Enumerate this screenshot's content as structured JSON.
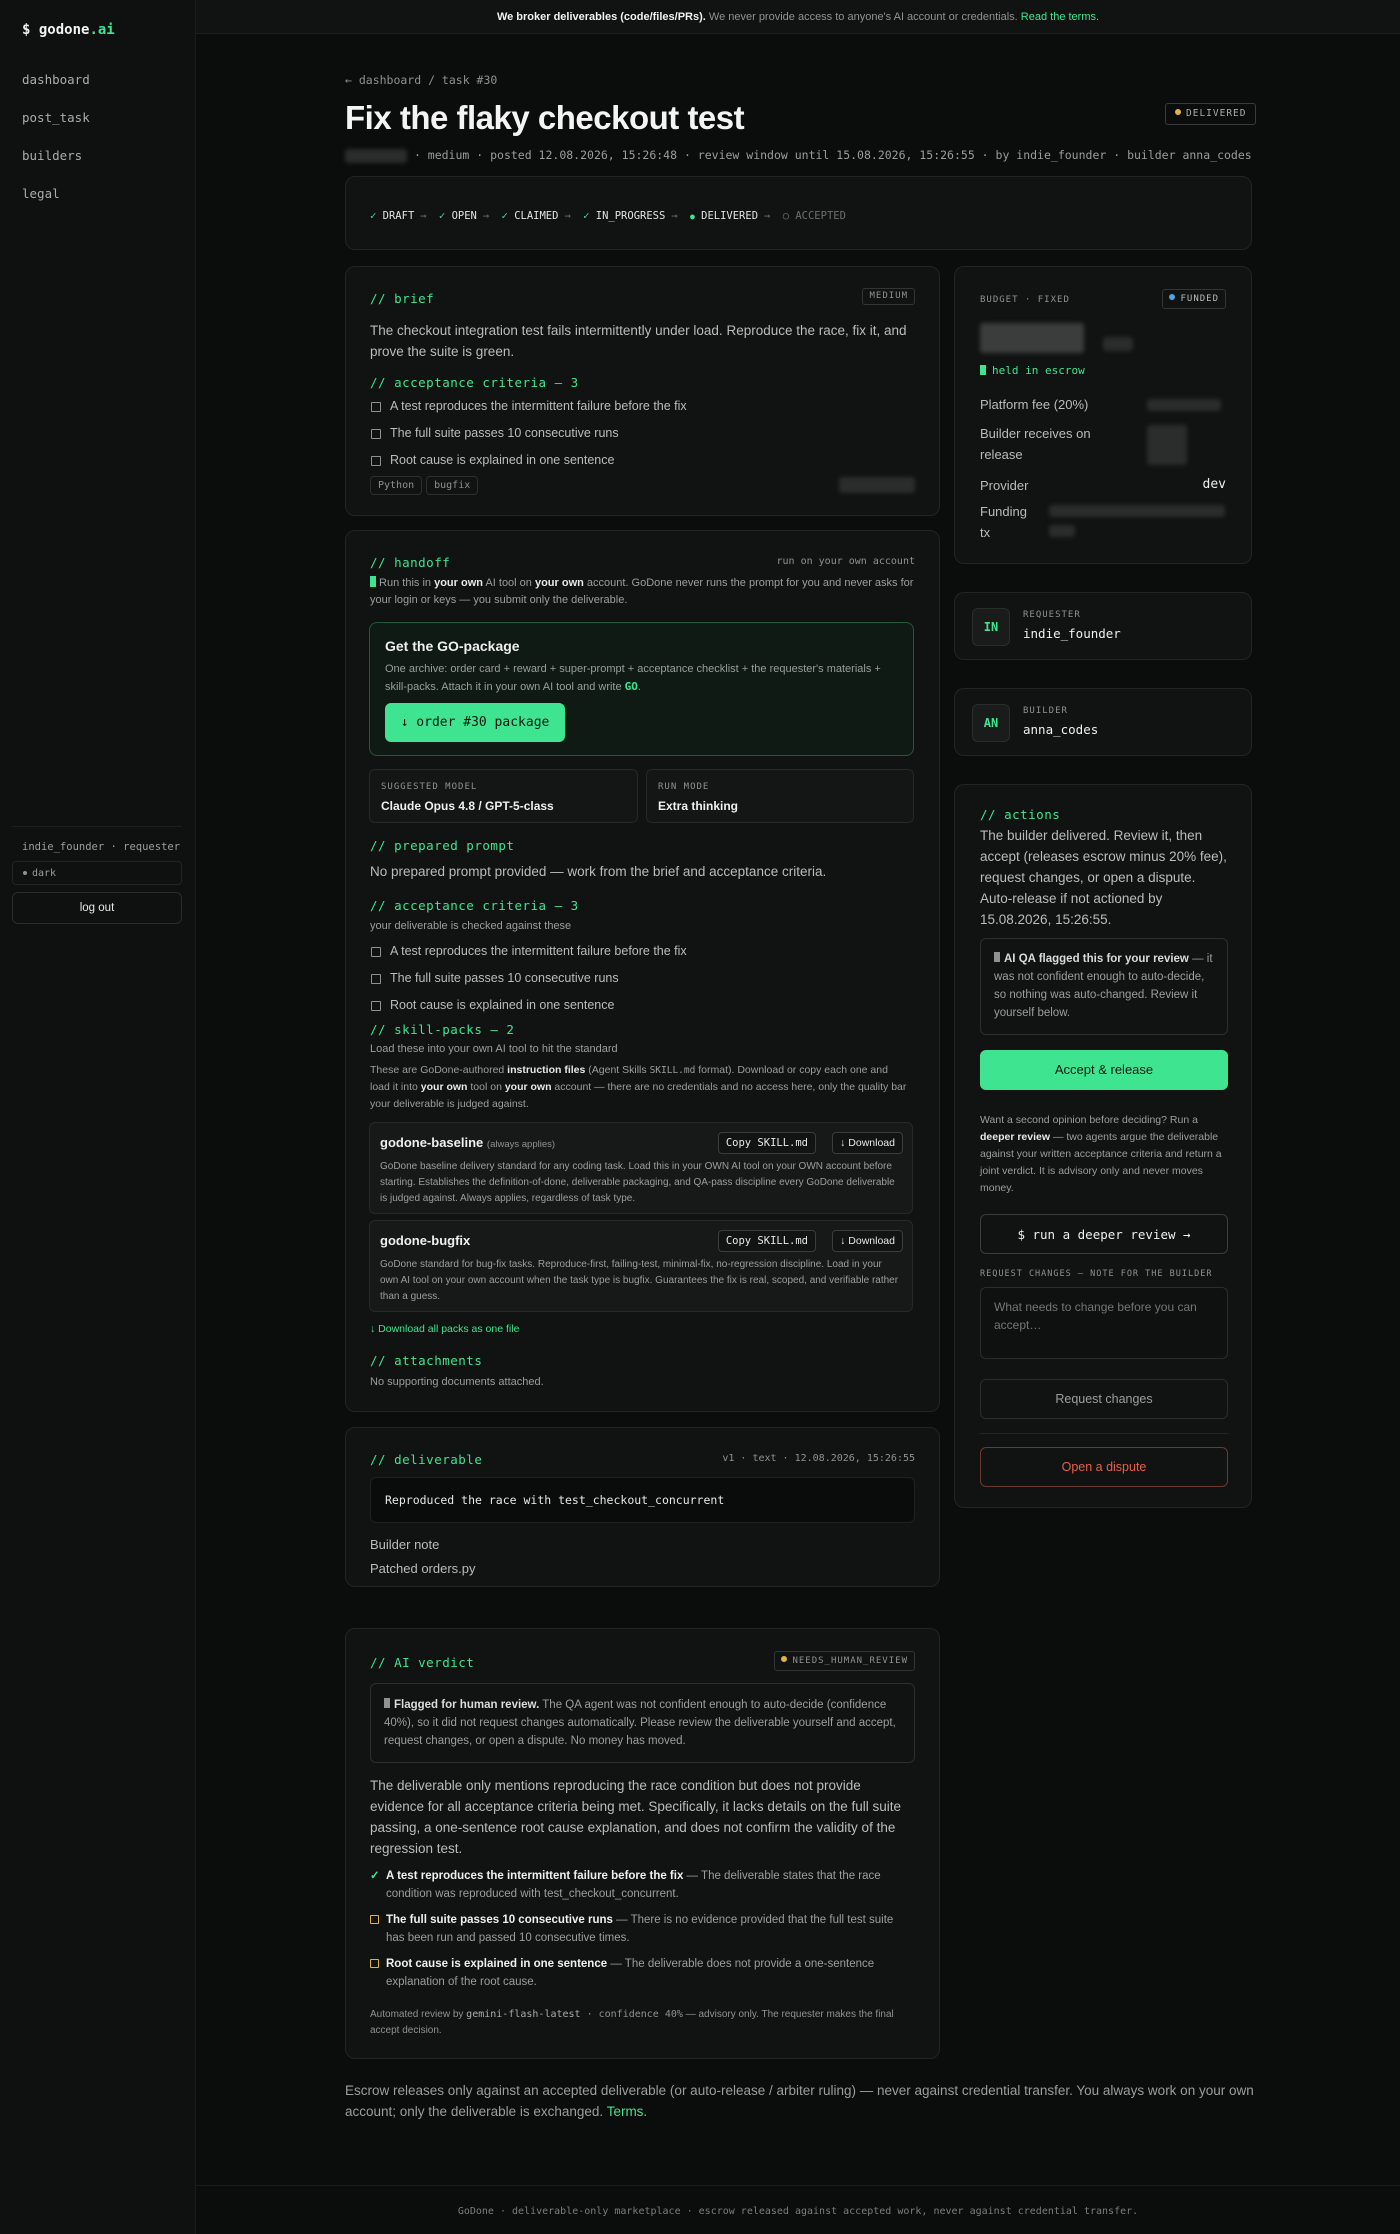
{
  "brand": {
    "prefix": "$ ",
    "name": "godone",
    ".ai": ".ai",
    "suffix": ".ai"
  },
  "nav": [
    "dashboard",
    "post_task",
    "builders",
    "legal"
  ],
  "user": {
    "label": "indie_founder · requester",
    "theme": "dark",
    "logout": "log out"
  },
  "banner": {
    "bold": "We broker deliverables (code/files/PRs).",
    "text": " We never provide access to anyone's AI account or credentials. ",
    "link": "Read the terms."
  },
  "breadcrumb": "← dashboard / task #30",
  "task": {
    "title": "Fix the flaky checkout test",
    "status": "DELIVERED",
    "meta": "· medium · posted 12.08.2026, 15:26:48 · review window until 15.08.2026, 15:26:55 · by indie_founder · builder anna_codes"
  },
  "steps": [
    {
      "mark": "✓",
      "label": "DRAFT"
    },
    {
      "mark": "✓",
      "label": "OPEN"
    },
    {
      "mark": "✓",
      "label": "CLAIMED"
    },
    {
      "mark": "✓",
      "label": "IN_PROGRESS"
    },
    {
      "mark": "●",
      "label": "DELIVERED"
    },
    {
      "mark": "○",
      "label": "ACCEPTED"
    }
  ],
  "step_arrow": "→",
  "brief": {
    "heading": "// brief",
    "chip": "MEDIUM",
    "text": "The checkout integration test fails intermittently under load. Reproduce the race, fix it, and prove the suite is green.",
    "criteria_heading": "// acceptance criteria — 3",
    "criteria": [
      "A test reproduces the intermittent failure before the fix",
      "The full suite passes 10 consecutive runs",
      "Root cause is explained in one sentence"
    ],
    "tags": [
      "Python",
      "bugfix"
    ]
  },
  "budget": {
    "label": "BUDGET · FIXED",
    "funded": "FUNDED",
    "escrow": "held in escrow",
    "fee": "Platform fee (20%)",
    "receives": "Builder receives on release",
    "provider_label": "Provider",
    "provider": "dev",
    "funding": "Funding tx"
  },
  "requester": {
    "initials": "IN",
    "label": "REQUESTER",
    "name": "indie_founder"
  },
  "builder": {
    "initials": "AN",
    "label": "BUILDER",
    "name": "anna_codes"
  },
  "handoff": {
    "heading": "// handoff",
    "right": "run on your own account",
    "note_pre": " Run this in ",
    "b1": "your own",
    "mid1": " AI tool on ",
    "b2": "your own",
    "note_post": " account. GoDone never runs the prompt for you and never asks for your login or keys — you submit only the deliverable."
  },
  "package": {
    "title": "Get the GO-package",
    "desc": "One archive: order card + reward + super-prompt + acceptance checklist + the requester's materials + skill-packs. Attach it in your own AI tool and write ",
    "go": "GO",
    "end": ".",
    "button": "↓ order #30 package"
  },
  "model": {
    "label": "SUGGESTED MODEL",
    "value": "Claude Opus 4.8 / GPT-5-class"
  },
  "runmode": {
    "label": "RUN MODE",
    "value": "Extra thinking"
  },
  "prompt": {
    "heading": "// prepared prompt",
    "text": "No prepared prompt provided — work from the brief and acceptance criteria."
  },
  "criteria2": {
    "heading": "// acceptance criteria — 3",
    "sub": "your deliverable is checked against these"
  },
  "skills": {
    "heading": "// skill-packs — 2",
    "sub": "Load these into your own AI tool to hit the standard",
    "d1": "These are GoDone-authored ",
    "b1": "instruction files",
    "d2": " (Agent Skills ",
    "code": "SKILL.md",
    "d3": " format). Download or copy each one and load it into ",
    "b2": "your own",
    "d4": " tool on ",
    "b3": "your own",
    "d5": " account — there are no credentials and no access here, only the quality bar your deliverable is judged against.",
    "packs": [
      {
        "name": "godone-baseline",
        "note": "(always applies)",
        "desc": "GoDone baseline delivery standard for any coding task. Load this in your OWN AI tool on your OWN account before starting. Establishes the definition-of-done, deliverable packaging, and QA-pass discipline every GoDone deliverable is judged against. Always applies, regardless of task type."
      },
      {
        "name": "godone-bugfix",
        "note": "",
        "desc": "GoDone standard for bug-fix tasks. Reproduce-first, failing-test, minimal-fix, no-regression discipline. Load in your own AI tool on your own account when the task type is bugfix. Guarantees the fix is real, scoped, and verifiable rather than a guess."
      }
    ],
    "copy": "Copy SKILL.md",
    "download": "↓ Download",
    "all": "↓ Download all packs as one file"
  },
  "attachments": {
    "heading": "// attachments",
    "text": "No supporting documents attached."
  },
  "deliverable": {
    "heading": "// deliverable",
    "meta": "v1 · text · 12.08.2026, 15:26:55",
    "code": "Reproduced the race with test_checkout_concurrent",
    "note_label": "Builder note",
    "note": "Patched orders.py"
  },
  "actions": {
    "heading": "// actions",
    "text": "The builder delivered. Review it, then accept (releases escrow minus 20% fee), request changes, or open a dispute. Auto-release if not actioned by 15.08.2026, 15:26:55.",
    "qa_b": "AI QA flagged this for your review",
    "qa": " — it was not confident enough to auto-decide, so nothing was auto-changed. Review it yourself below.",
    "accept": "Accept & release",
    "second_pre": "Want a second opinion before deciding? Run a ",
    "second_b": "deeper review",
    "second_post": " — two agents argue the deliverable against your written acceptance criteria and return a joint verdict. It is advisory only and never moves money.",
    "deeper": "$ run a deeper review →",
    "req_label": "REQUEST CHANGES — NOTE FOR THE BUILDER",
    "placeholder": "What needs to change before you can accept…",
    "request": "Request changes",
    "dispute": "Open a dispute"
  },
  "verdict": {
    "heading": "// AI verdict",
    "badge": "NEEDS_HUMAN_REVIEW",
    "flag_b": "Flagged for human review.",
    "flag": " The QA agent was not confident enough to auto-decide (confidence 40%), so it did not request changes automatically. Please review the deliverable yourself and accept, request changes, or open a dispute. No money has moved.",
    "summary": "The deliverable only mentions reproducing the race condition but does not provide evidence for all acceptance criteria being met. Specifically, it lacks details on the full suite passing, a one-sentence root cause explanation, and does not confirm the validity of the regression test.",
    "items": [
      {
        "mark": "✓",
        "title": "A test reproduces the intermittent failure before the fix",
        "text": " — The deliverable states that the race condition was reproduced with test_checkout_concurrent."
      },
      {
        "mark": "□",
        "title": "The full suite passes 10 consecutive runs",
        "text": " — There is no evidence provided that the full test suite has been run and passed 10 consecutive times."
      },
      {
        "mark": "□",
        "title": "Root cause is explained in one sentence",
        "text": " — The deliverable does not provide a one-sentence explanation of the root cause."
      }
    ],
    "foot_pre": "Automated review by ",
    "model": "gemini-flash-latest",
    "conf": " · confidence 40%",
    "foot_post": " — advisory only. The requester makes the final accept decision."
  },
  "escrow_note": {
    "text": "Escrow releases only against an accepted deliverable (or auto-release / arbiter ruling) — never against credential transfer. You always work on your own account; only the deliverable is exchanged. ",
    "link": "Terms."
  },
  "footer": "GoDone · deliverable-only marketplace · escrow released against accepted work, never against credential transfer.",
  "colors": {
    "accent": "#3ee48f",
    "bg": "#0b0c0c",
    "warn": "#e3b341",
    "danger": "#e5604a"
  }
}
